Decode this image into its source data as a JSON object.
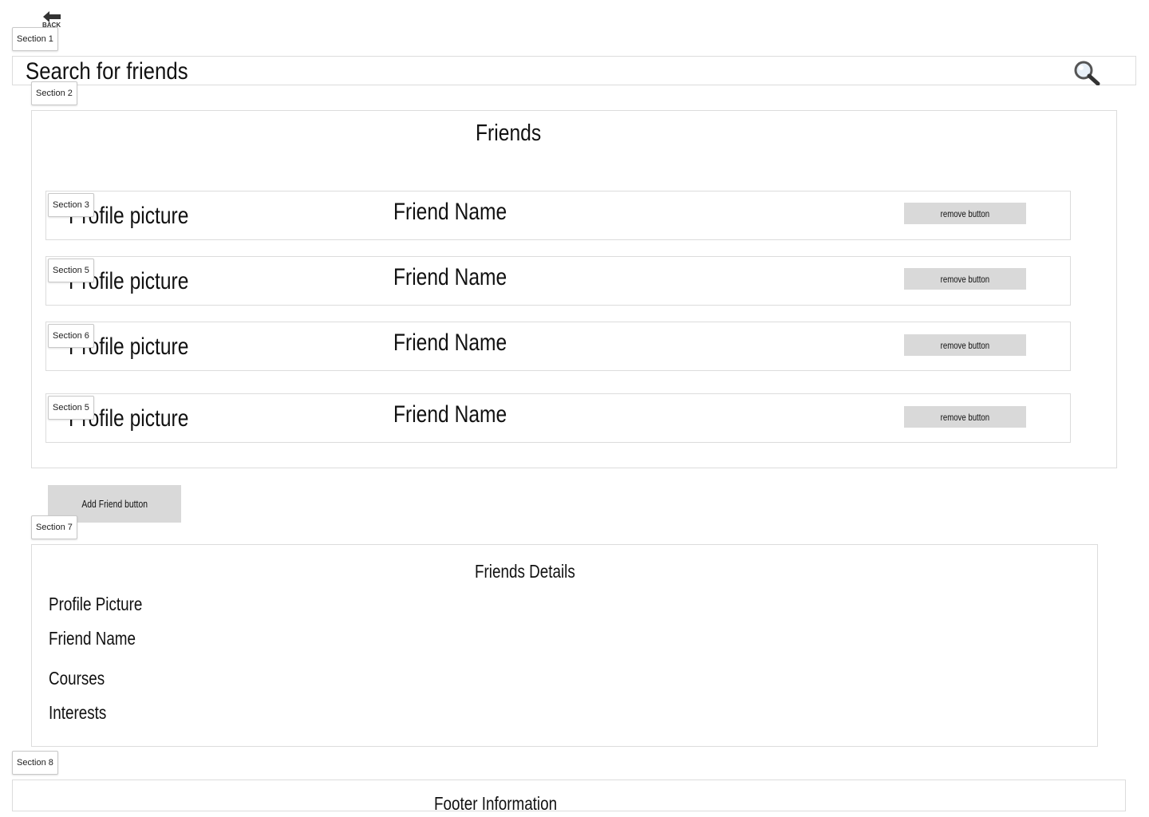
{
  "header": {
    "back_label": "BACK",
    "section_tag": "Section 1"
  },
  "search": {
    "placeholder": "Search  for friends",
    "icon": "magnifier-icon"
  },
  "friends_panel": {
    "section_tag": "Section 2",
    "title": "Friends",
    "rows": [
      {
        "section_tag": "Section 3",
        "picture_label": "Profile picture",
        "name": "Friend Name",
        "remove_label": "remove button"
      },
      {
        "section_tag": "Section 5",
        "picture_label": "Profile picture",
        "name": "Friend Name",
        "remove_label": "remove button"
      },
      {
        "section_tag": "Section 6",
        "picture_label": "Profile picture",
        "name": "Friend Name",
        "remove_label": "remove button"
      },
      {
        "section_tag": "Section 5",
        "picture_label": "Profile picture",
        "name": "Friend Name",
        "remove_label": "remove button"
      }
    ]
  },
  "add_friend": {
    "label": "Add  Friend button"
  },
  "details": {
    "section_tag": "Section 7",
    "title": "Friends Details",
    "fields": [
      "Profile Picture",
      "Friend Name",
      "Courses",
      "Interests"
    ]
  },
  "footer": {
    "section_tag": "Section 8",
    "text": "Footer Information"
  },
  "colors": {
    "button_gray": "#d9d9d9",
    "border": "#dcdcdc"
  }
}
